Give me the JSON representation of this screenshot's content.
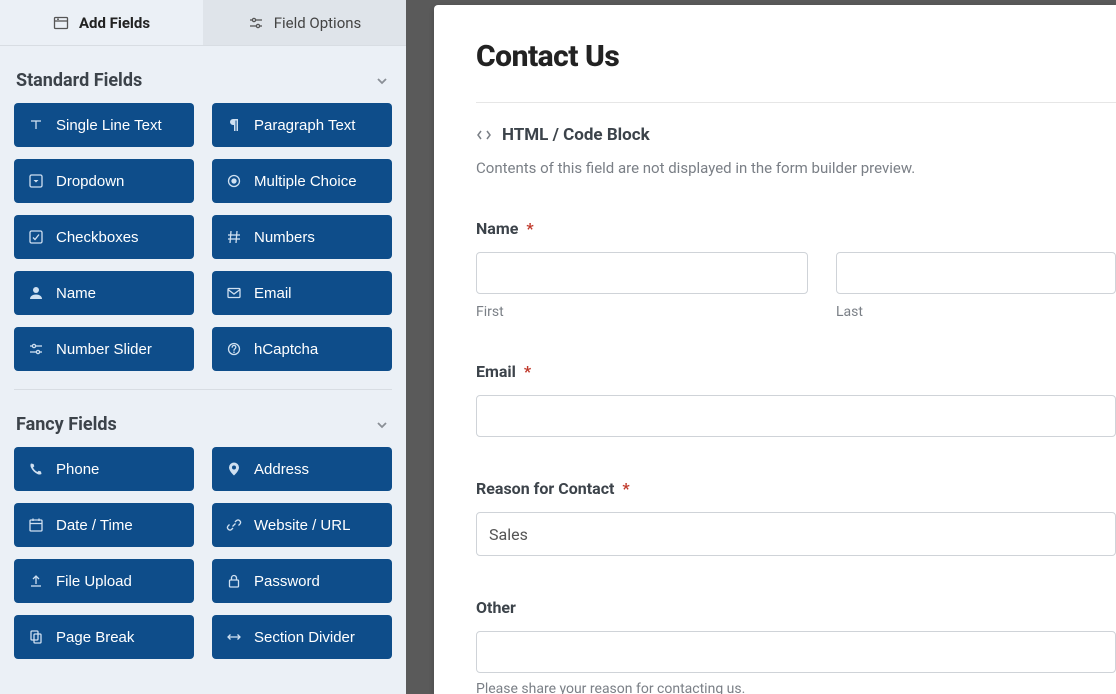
{
  "tabs": {
    "add_fields": "Add Fields",
    "field_options": "Field Options"
  },
  "sections": {
    "standard": {
      "title": "Standard Fields",
      "items": [
        "Single Line Text",
        "Paragraph Text",
        "Dropdown",
        "Multiple Choice",
        "Checkboxes",
        "Numbers",
        "Name",
        "Email",
        "Number Slider",
        "hCaptcha"
      ]
    },
    "fancy": {
      "title": "Fancy Fields",
      "items": [
        "Phone",
        "Address",
        "Date / Time",
        "Website / URL",
        "File Upload",
        "Password",
        "Page Break",
        "Section Divider"
      ]
    }
  },
  "preview": {
    "form_title": "Contact Us",
    "codeblock": {
      "label": "HTML / Code Block",
      "desc": "Contents of this field are not displayed in the form builder preview."
    },
    "name_field": {
      "label": "Name",
      "first_sub": "First",
      "last_sub": "Last"
    },
    "email_field": {
      "label": "Email"
    },
    "reason_field": {
      "label": "Reason for Contact",
      "selected": "Sales"
    },
    "other_field": {
      "label": "Other",
      "helper": "Please share your reason for contacting us."
    },
    "required_mark": "*"
  }
}
